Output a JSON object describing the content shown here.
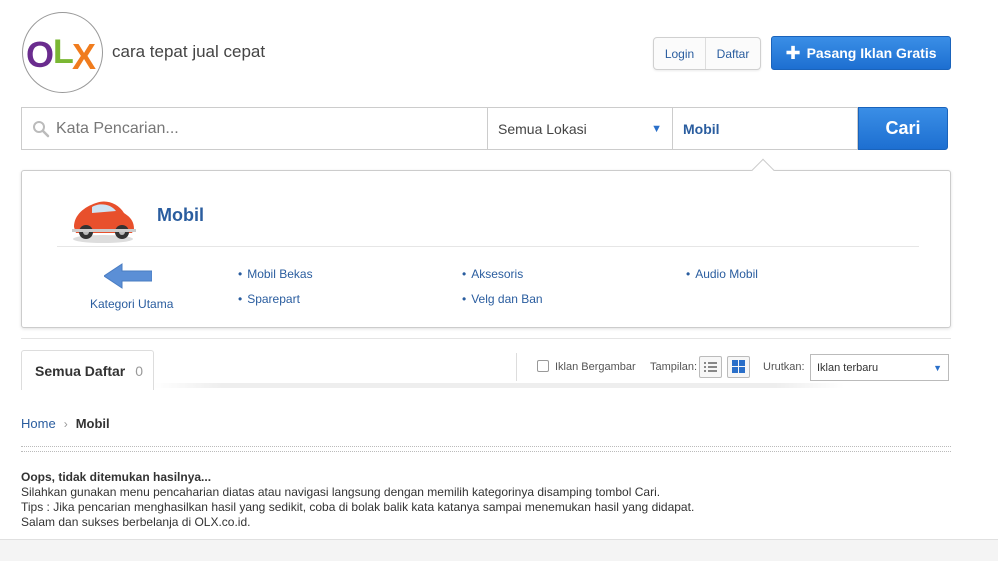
{
  "header": {
    "tagline": "cara tepat jual cepat",
    "login_label": "Login",
    "daftar_label": "Daftar",
    "pasang_label": "Pasang Iklan Gratis"
  },
  "search": {
    "placeholder": "Kata Pencarian...",
    "location": "Semua Lokasi",
    "category": "Mobil",
    "submit_label": "Cari"
  },
  "category_panel": {
    "title": "Mobil",
    "back_label": "Kategori Utama",
    "subcategories": [
      "Mobil Bekas",
      "Aksesoris",
      "Audio Mobil",
      "Sparepart",
      "Velg dan Ban"
    ]
  },
  "toolbar": {
    "tab_label": "Semua Daftar",
    "tab_count": "0",
    "checkbox_label": "Iklan Bergambar",
    "view_label": "Tampilan:",
    "sort_label": "Urutkan:",
    "sort_value": "Iklan terbaru"
  },
  "breadcrumb": {
    "home": "Home",
    "current": "Mobil"
  },
  "message": {
    "heading": "Oops, tidak ditemukan hasilnya...",
    "line1": "Silahkan gunakan menu pencaharian diatas atau navigasi langsung dengan memilih kategorinya disamping tombol Cari.",
    "line2": "Tips : Jika pencarian menghasilkan hasil yang sedikit, coba di bolak balik kata katanya sampai menemukan hasil yang didapat.",
    "line3": "Salam dan sukses berbelanja di OLX.co.id."
  },
  "colors": {
    "accent": "#1d6fd1",
    "link": "#2a5d9f"
  }
}
